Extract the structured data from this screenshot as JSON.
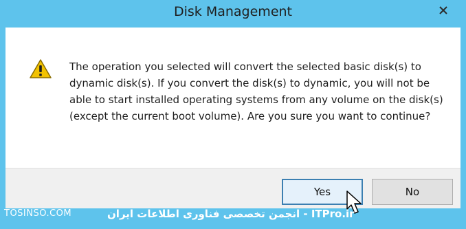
{
  "window": {
    "title": "Disk Management",
    "close_icon": "close-icon"
  },
  "dialog": {
    "icon": "warning-icon",
    "message": "The operation you selected will convert the selected basic disk(s) to dynamic disk(s). If you convert the disk(s) to dynamic, you will not be able to start installed operating systems from any volume on the disk(s) (except the current boot volume). Are you sure you want to continue?"
  },
  "buttons": {
    "yes_label": "Yes",
    "no_label": "No"
  },
  "watermark": {
    "site": "TOSINSO.COM",
    "brand": "انجمن تخصصی فناوری اطلاعات ایران - ITPro.ir"
  },
  "colors": {
    "frame": "#5ec3ec",
    "warning": "#f2c200",
    "focus": "#3c7fb1"
  }
}
